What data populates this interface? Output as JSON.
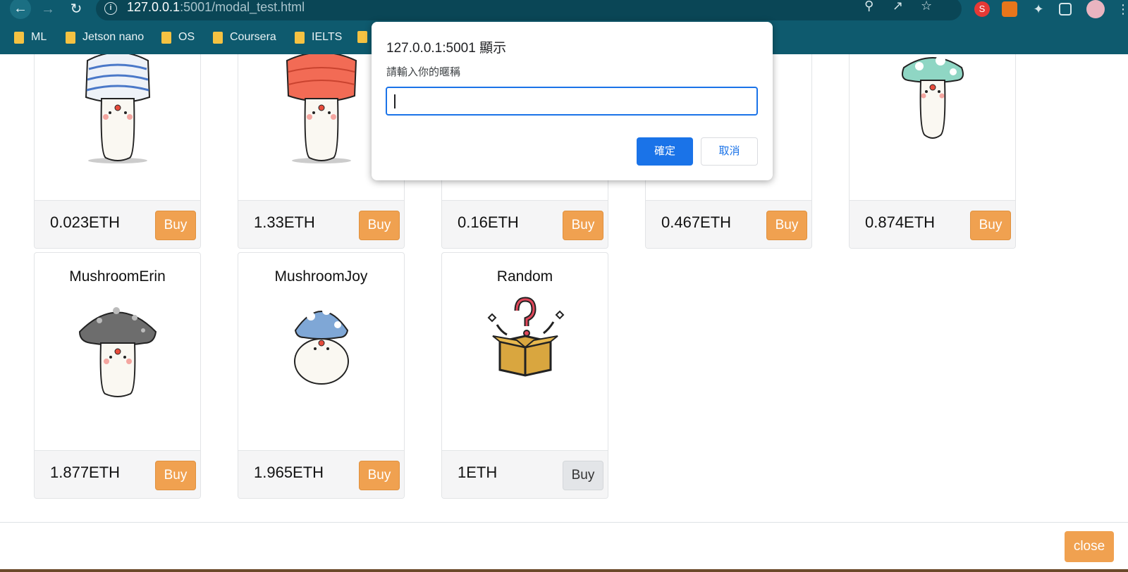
{
  "browser": {
    "url_host": "127.0.0.1",
    "url_rest": ":5001/modal_test.html",
    "bookmarks": [
      "ML",
      "Jetson nano",
      "OS",
      "Coursera",
      "IELTS"
    ],
    "extensions": {
      "s_label": "S"
    }
  },
  "products_row1": [
    {
      "price": "0.023ETH",
      "buy_label": "Buy"
    },
    {
      "price": "1.33ETH",
      "buy_label": "Buy"
    },
    {
      "price": "0.16ETH",
      "buy_label": "Buy"
    },
    {
      "price": "0.467ETH",
      "buy_label": "Buy"
    },
    {
      "price": "0.874ETH",
      "buy_label": "Buy"
    }
  ],
  "products_row2": [
    {
      "name": "MushroomErin",
      "price": "1.877ETH",
      "buy_label": "Buy"
    },
    {
      "name": "MushroomJoy",
      "price": "1.965ETH",
      "buy_label": "Buy"
    },
    {
      "name": "Random",
      "price": "1ETH",
      "buy_label": "Buy"
    }
  ],
  "modal": {
    "close_label": "close"
  },
  "dialog": {
    "title": "127.0.0.1:5001 顯示",
    "message": "請輸入你的暱稱",
    "input_value": "",
    "ok_label": "確定",
    "cancel_label": "取消"
  },
  "colors": {
    "chrome": "#0e5a6e",
    "buy": "#f0a150",
    "dialog_accent": "#1a73e8"
  }
}
